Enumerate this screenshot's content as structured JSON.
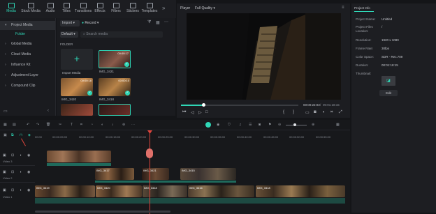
{
  "toolbar": {
    "items": [
      {
        "label": "Media",
        "icon": "media-icon",
        "active": true
      },
      {
        "label": "Stock Media",
        "icon": "stock-media-icon"
      },
      {
        "label": "Audio",
        "icon": "audio-icon"
      },
      {
        "label": "Titles",
        "icon": "titles-icon"
      },
      {
        "label": "Transitions",
        "icon": "transitions-icon"
      },
      {
        "label": "Effects",
        "icon": "effects-icon"
      },
      {
        "label": "Filters",
        "icon": "filters-icon"
      },
      {
        "label": "Stickers",
        "icon": "stickers-icon"
      },
      {
        "label": "Templates",
        "icon": "templates-icon"
      }
    ]
  },
  "leftnav": {
    "items": [
      "Project Media",
      "Folder",
      "Global Media",
      "Cloud Media",
      "Influence Kit",
      "Adjustment Layer",
      "Compound Clip"
    ]
  },
  "media": {
    "import_label": "Import",
    "record_label": "Record",
    "default_label": "Default",
    "search_placeholder": "Search media",
    "folder_header": "FOLDER",
    "import_media_label": "Import Media",
    "items": [
      {
        "name": "IMG_3421",
        "duration": "00:00:17"
      },
      {
        "name": "IMG_3420",
        "duration": "00:00:18"
      },
      {
        "name": "IMG_3418",
        "duration": "00:00:10"
      }
    ]
  },
  "player": {
    "tab_player": "Player",
    "quality": "Full Quality",
    "time_current": "00:00:22:03",
    "time_total": "00:01:18:15",
    "progress": 0.19
  },
  "info": {
    "title": "Project Info",
    "rows": [
      {
        "key": "Project Name:",
        "value": "Untitled"
      },
      {
        "key": "Project Files Location:",
        "value": "/"
      },
      {
        "key": "Resolution:",
        "value": "1920 x 1080"
      },
      {
        "key": "Frame Rate:",
        "value": "30fps"
      },
      {
        "key": "Color Space:",
        "value": "SDR - Rec.709"
      },
      {
        "key": "Duration:",
        "value": "00:01:18:15"
      }
    ],
    "thumbnail_label": "Thumbnail:",
    "edit_label": "Edit"
  },
  "timeline": {
    "ruler": [
      "00:00",
      "00:00:05:00",
      "00:00:10:00",
      "00:00:15:00",
      "00:00:20:00",
      "00:00:25:00",
      "00:00:30:00",
      "00:00:35:00",
      "00:00:40:00",
      "00:00:45:00",
      "00:00:50:00",
      "00:00:55:00"
    ],
    "tracks": [
      "Video 3",
      "Video 2",
      "Video 1"
    ],
    "clips_v2": [
      "IMG_3417",
      "IMG_3421",
      "IMG_3415"
    ],
    "clips_v1": [
      "IMG_3419",
      "IMG_3420",
      "IMG_3418",
      "IMG_3416",
      "IMG_3418"
    ]
  }
}
